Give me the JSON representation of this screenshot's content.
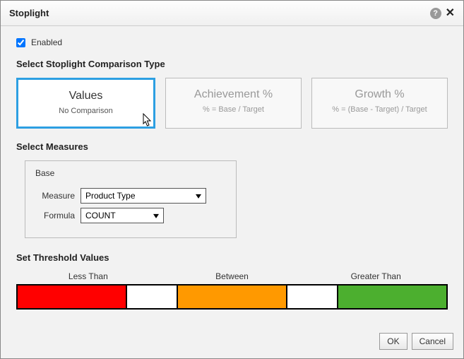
{
  "dialog": {
    "title": "Stoplight"
  },
  "enabled": {
    "label": "Enabled",
    "checked": true
  },
  "sections": {
    "type_header": "Select Stoplight Comparison Type",
    "measures_header": "Select Measures",
    "threshold_header": "Set Threshold Values"
  },
  "types": [
    {
      "title": "Values",
      "subtitle": "No Comparison",
      "selected": true
    },
    {
      "title": "Achievement %",
      "subtitle": "% = Base / Target",
      "selected": false
    },
    {
      "title": "Growth %",
      "subtitle": "% = (Base - Target) / Target",
      "selected": false
    }
  ],
  "measures": {
    "legend": "Base",
    "measure_label": "Measure",
    "measure_value": "Product Type",
    "formula_label": "Formula",
    "formula_value": "COUNT"
  },
  "thresholds": {
    "labels": {
      "less": "Less Than",
      "between": "Between",
      "greater": "Greater Than"
    },
    "colors": {
      "low": "#ff0000",
      "mid": "#ff9900",
      "high": "#4caf2f"
    },
    "low_value": "",
    "high_value": ""
  },
  "buttons": {
    "ok": "OK",
    "cancel": "Cancel"
  }
}
